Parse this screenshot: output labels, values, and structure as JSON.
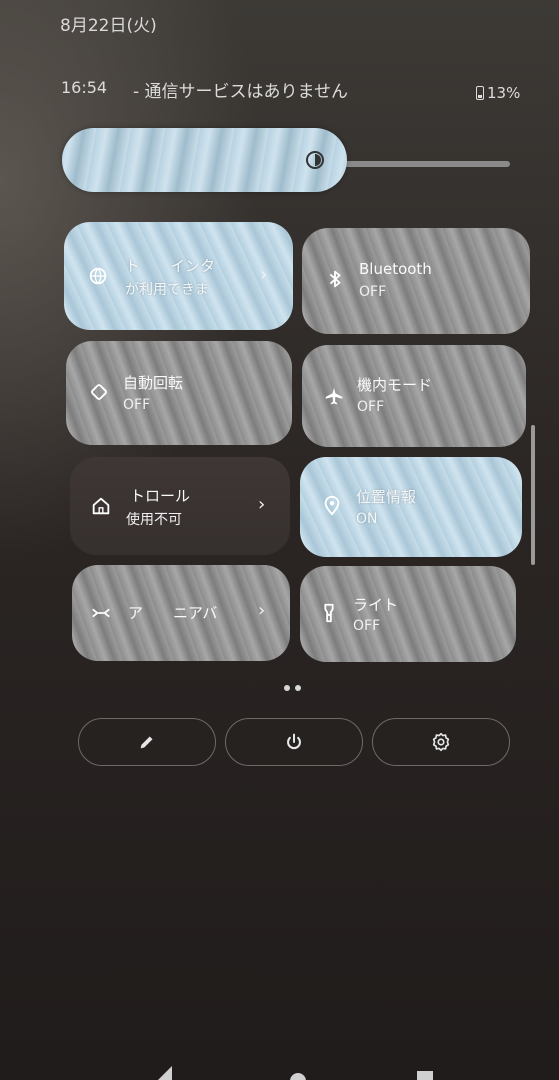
{
  "status": {
    "date": "8月22日(火)",
    "time": "16:54",
    "carrier": "- 通信サービスはありません",
    "battery": "13%"
  },
  "brightness": {
    "level_percent": 55,
    "icon": "brightness-icon"
  },
  "tiles": [
    {
      "title": "ト　　インタ",
      "subtitle": "が利用できま",
      "icon": "internet-icon",
      "state": "on",
      "chevron": true
    },
    {
      "title": "Bluetooth",
      "subtitle": "OFF",
      "icon": "bluetooth-icon",
      "state": "off",
      "chevron": false
    },
    {
      "title": "自動回転",
      "subtitle": "OFF",
      "icon": "auto-rotate-icon",
      "state": "off",
      "chevron": false
    },
    {
      "title": "機内モード",
      "subtitle": "OFF",
      "icon": "airplane-icon",
      "state": "off",
      "chevron": false
    },
    {
      "title": "トロール",
      "subtitle": "使用不可",
      "icon": "home-icon",
      "state": "dark",
      "chevron": true
    },
    {
      "title": "位置情報",
      "subtitle": "ON",
      "icon": "location-icon",
      "state": "on",
      "chevron": false
    },
    {
      "title": "ア　　ニアバ",
      "subtitle": "",
      "icon": "nearby-share-icon",
      "state": "off",
      "chevron": true
    },
    {
      "title": "ライト",
      "subtitle": "OFF",
      "icon": "flashlight-icon",
      "state": "off",
      "chevron": false
    }
  ],
  "footer_buttons": [
    {
      "icon": "edit-pencil-icon"
    },
    {
      "icon": "power-icon"
    },
    {
      "icon": "settings-gear-icon"
    }
  ],
  "chevron_glyph": "›",
  "colors": {
    "tile_on": "#c0d9e6",
    "tile_off": "#959595",
    "tile_dark": "#3a3331",
    "background": "#2a2523"
  }
}
